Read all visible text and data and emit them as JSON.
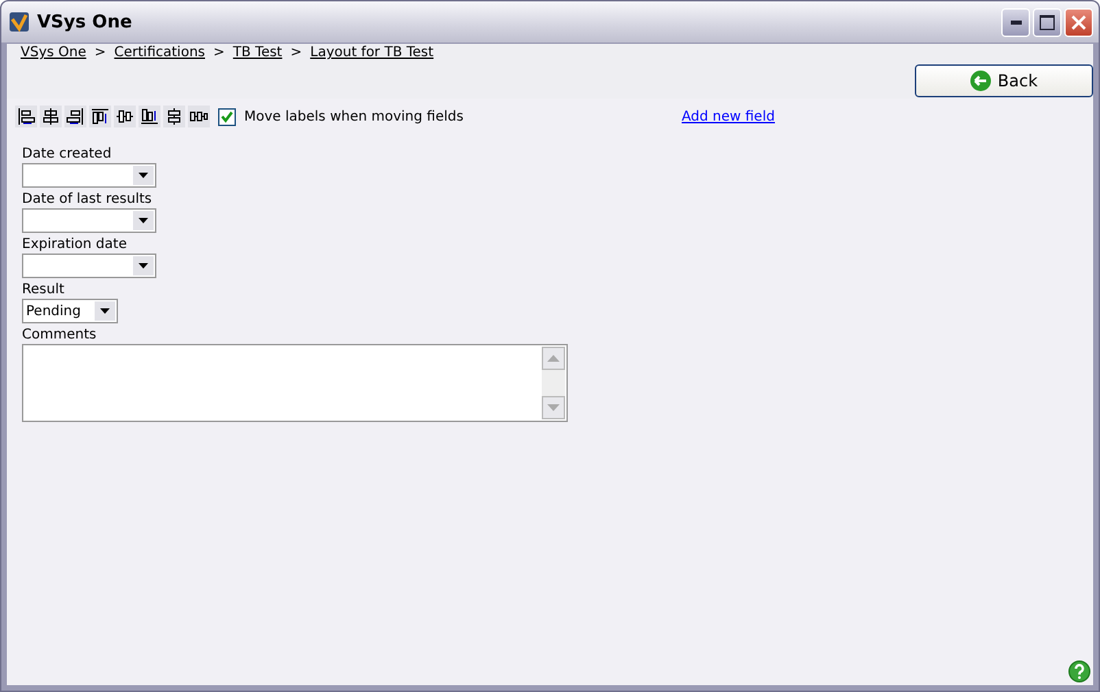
{
  "window": {
    "title": "VSys One"
  },
  "breadcrumb": [
    {
      "kind": "link",
      "label": "VSys One"
    },
    {
      "kind": "separator",
      "label": ">"
    },
    {
      "kind": "link",
      "label": "Certifications"
    },
    {
      "kind": "separator",
      "label": ">"
    },
    {
      "kind": "link",
      "label": "TB Test"
    },
    {
      "kind": "separator",
      "label": ">"
    },
    {
      "kind": "link",
      "label": "Layout for TB Test"
    }
  ],
  "back_button": {
    "label": "Back"
  },
  "move_labels": {
    "label": "Move labels when moving fields",
    "checked": true
  },
  "add_field_link": {
    "label": "Add new field"
  },
  "fields": [
    {
      "kind": "dropdown",
      "label": "Date created"
    },
    {
      "kind": "dropdown",
      "label": "Date of last results"
    },
    {
      "kind": "dropdown",
      "label": "Expiration date"
    },
    {
      "kind": "short-dropdown",
      "label": "Result",
      "value": "Pending"
    },
    {
      "kind": "textarea",
      "label": "Comments"
    }
  ]
}
